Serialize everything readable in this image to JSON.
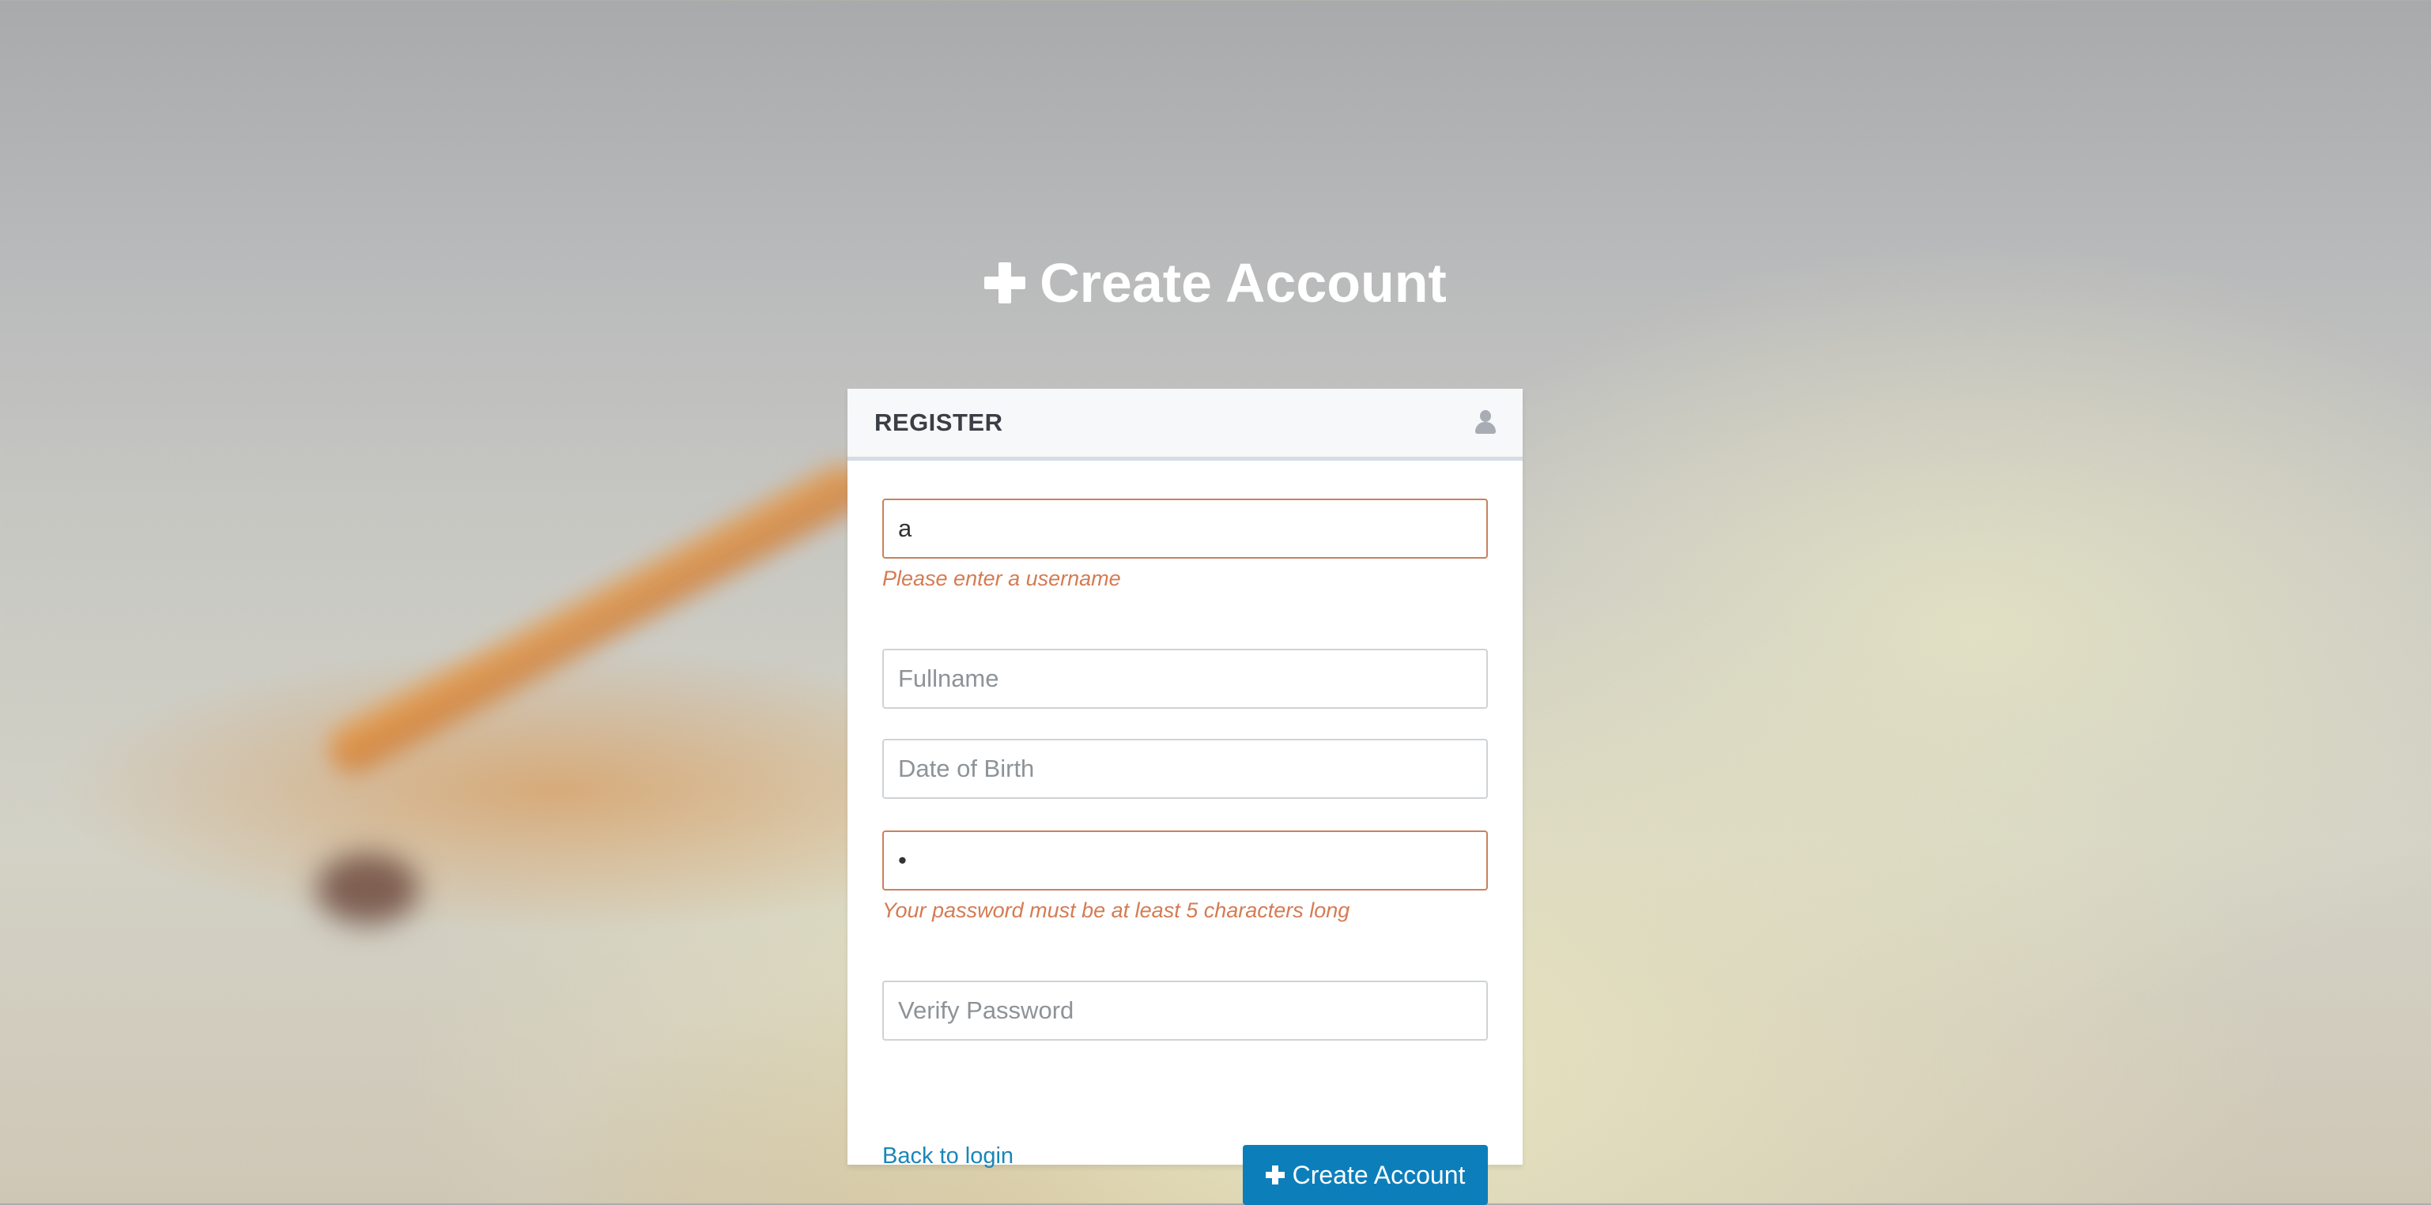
{
  "page": {
    "title": "Create Account"
  },
  "register_card": {
    "title": "REGISTER",
    "header_icon": "user-icon",
    "fields": {
      "username": {
        "value": "a",
        "placeholder": "",
        "state": "error",
        "error": "Please enter a username"
      },
      "fullname": {
        "value": "",
        "placeholder": "Fullname"
      },
      "date_of_birth": {
        "value": "",
        "placeholder": "Date of Birth"
      },
      "password": {
        "value": "•",
        "placeholder": "",
        "state": "error",
        "error": "Your password must be at least 5 characters long"
      },
      "verify_password": {
        "value": "",
        "placeholder": "Verify Password"
      }
    },
    "back_link": "Back to login",
    "submit_label": "Create Account"
  },
  "colors": {
    "primary_button": "#0c7fbb",
    "error_text": "#d57b52",
    "error_border": "#c8825d",
    "link": "#1a86b8"
  }
}
